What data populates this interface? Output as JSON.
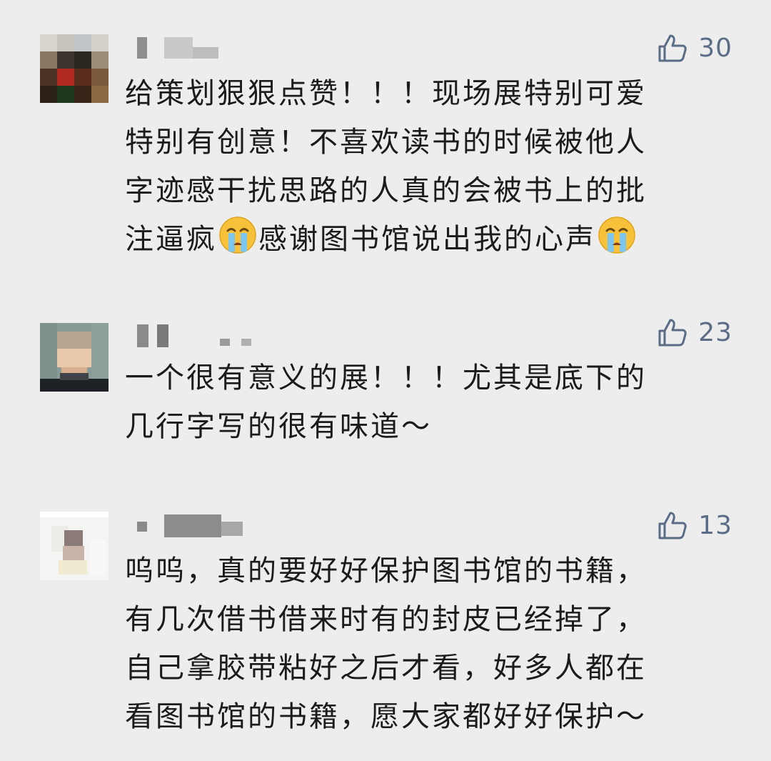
{
  "comments": [
    {
      "username_blurred": true,
      "likes": "30",
      "lines": [
        "给策划狠狠点赞！！！现场展特别可爱",
        "特别有创意！不喜欢读书的时候被他人",
        "字迹感干扰思路的人真的会被书上的批"
      ],
      "last_line": {
        "part1": "注逼疯",
        "part2": "感谢图书馆说出我的心声"
      },
      "emoji": "crying-face"
    },
    {
      "username_blurred": true,
      "likes": "23",
      "lines": [
        "一个很有意义的展！！！尤其是底下的",
        "几行字写的很有味道～"
      ]
    },
    {
      "username_blurred": true,
      "likes": "13",
      "lines": [
        "呜呜，真的要好好保护图书馆的书籍，",
        "有几次借书借来时有的封皮已经掉了，",
        "自己拿胶带粘好之后才看，好多人都在",
        "看图书馆的书籍，愿大家都好好保护～"
      ]
    }
  ],
  "colors": {
    "background": "#ededed",
    "text": "#1b1b1b",
    "like": "#5a6c86"
  },
  "icons": {
    "like": "thumbs-up-icon",
    "emoji": "crying-face-emoji"
  }
}
